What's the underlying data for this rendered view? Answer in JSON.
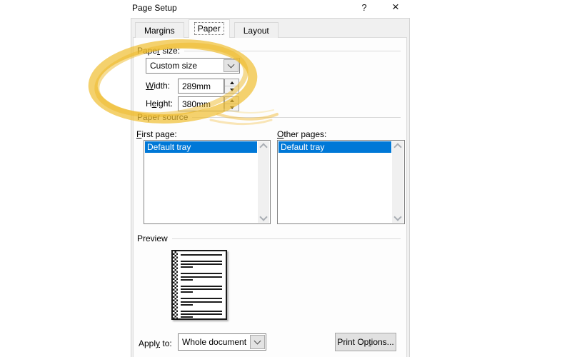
{
  "window": {
    "title": "Page Setup",
    "help_icon": "?",
    "close_icon": "×"
  },
  "tabs": [
    {
      "label": "Margins",
      "selected": false
    },
    {
      "label": "Paper",
      "selected": true
    },
    {
      "label": "Layout",
      "selected": false
    }
  ],
  "paper_size": {
    "group_label": {
      "pre": "Pape",
      "accel": "r",
      "post": " size:"
    },
    "size_dropdown": {
      "value": "Custom size"
    },
    "width_field": {
      "label": {
        "pre": "",
        "accel": "W",
        "post": "idth:"
      },
      "value": "289mm"
    },
    "height_field": {
      "label": {
        "pre": "H",
        "accel": "e",
        "post": "ight:"
      },
      "value": "380mm"
    }
  },
  "paper_source": {
    "group_label": "Paper source",
    "first_page": {
      "label": {
        "pre": "",
        "accel": "F",
        "post": "irst page:"
      },
      "items": [
        "Default tray"
      ],
      "selected": "Default tray"
    },
    "other_pages": {
      "label": {
        "pre": "",
        "accel": "O",
        "post": "ther pages:"
      },
      "items": [
        "Default tray"
      ],
      "selected": "Default tray"
    }
  },
  "preview": {
    "group_label": "Preview",
    "page_lines": [
      100,
      0,
      100,
      100,
      30,
      0,
      100,
      100,
      30,
      0,
      100,
      100,
      30,
      0,
      100,
      100,
      30,
      0,
      100,
      100,
      30
    ]
  },
  "footer": {
    "apply_to": {
      "label": {
        "pre": "Appl",
        "accel": "y",
        "post": " to:"
      },
      "value": "Whole document"
    },
    "print_options_button": {
      "pre": "Print Op",
      "accel": "t",
      "post": "ions..."
    }
  },
  "annotation": {
    "shape": "hand-drawn highlighter ellipse",
    "target": "paper size custom dimensions",
    "color": "#f0be2f"
  },
  "colors": {
    "selection": "#0078d7",
    "highlighter": "#f0be2f",
    "dialog_bg": "#f0f0f0"
  }
}
